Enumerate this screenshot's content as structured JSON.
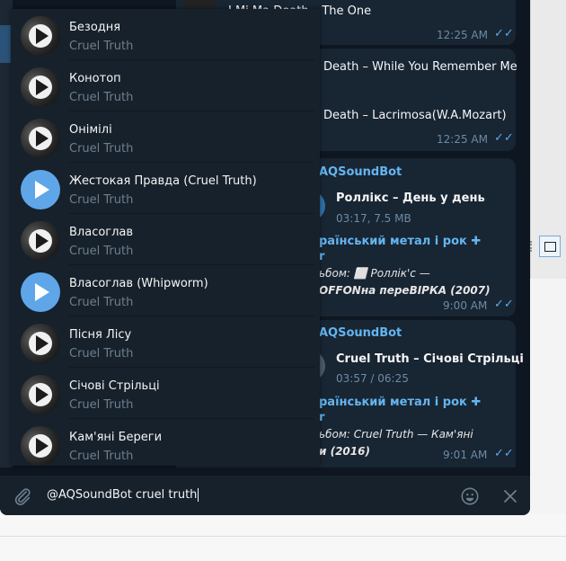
{
  "chat": {
    "top_message": {
      "text": "J.Mi  Ma Death – The One",
      "time": "12:25 AM",
      "ticks": "✓✓"
    },
    "death_message": {
      "line1": "Death – While You Remember Me",
      "line2": "Death – Lacrimosa(W.A.Mozart)",
      "time": "12:25 AM",
      "ticks": "✓✓"
    },
    "msg_rollix": {
      "bot": "AQSoundBot",
      "title": "Роллікс – День у день",
      "meta": "03:17, 7.5 MB",
      "channel_line1": "раїнський метал і рок ✚",
      "channel_line2": "r",
      "album_line1": "ьбом: ⬜ Роллік'с  —",
      "album_line2": "OFFONна переВІРКА (2007)",
      "time": "9:00 AM",
      "ticks": "✓✓"
    },
    "msg_cruel": {
      "bot": "AQSoundBot",
      "title": "Cruel Truth – Січові Стрільці",
      "meta": "03:57 / 06:25",
      "channel_line1": "раїнський метал і рок ✚",
      "channel_line2": "r",
      "album_line1": "ьбом: Cruel Truth  —  Кам'яні",
      "album_line2": "и (2016)",
      "time": "9:01 AM",
      "ticks": "✓✓"
    }
  },
  "results": [
    {
      "title": "Безодня",
      "artist": "Cruel Truth",
      "thumb": "dark"
    },
    {
      "title": "Конотоп",
      "artist": "Cruel Truth",
      "thumb": "dark"
    },
    {
      "title": "Онімілі",
      "artist": "Cruel Truth",
      "thumb": "dark"
    },
    {
      "title": "Жестокая Правда (Cruel Truth)",
      "artist": "Cruel Truth",
      "thumb": "blue"
    },
    {
      "title": "Власоглав",
      "artist": "Cruel Truth",
      "thumb": "dark"
    },
    {
      "title": "Власоглав (Whipworm)",
      "artist": "Cruel Truth",
      "thumb": "blue"
    },
    {
      "title": "Пісня Лісу",
      "artist": "Cruel Truth",
      "thumb": "dark"
    },
    {
      "title": "Січові Стрільці",
      "artist": "Cruel Truth",
      "thumb": "dark"
    },
    {
      "title": "Кам'яні Береги",
      "artist": "Cruel Truth",
      "thumb": "dark"
    }
  ],
  "compose": {
    "text": "@AQSoundBot cruel truth",
    "attach_icon": "paperclip-icon",
    "emoji_icon": "emoji-icon",
    "close_icon": "close-icon"
  },
  "colors": {
    "background": "#0e1621",
    "panel": "#17212b",
    "bubble": "#182533",
    "accent": "#64b5ef",
    "play_blue": "#5ea6e8"
  }
}
